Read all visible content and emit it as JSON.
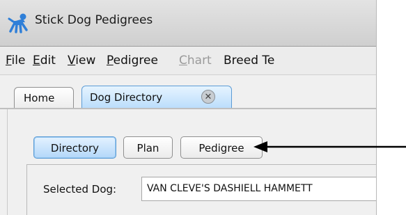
{
  "window": {
    "title": "Stick Dog Pedigrees",
    "app_icon": "stick-dog-icon"
  },
  "menubar": {
    "items": [
      {
        "mnemonic": "F",
        "rest": "ile",
        "enabled": true
      },
      {
        "mnemonic": "E",
        "rest": "dit",
        "enabled": true
      },
      {
        "mnemonic": "V",
        "rest": "iew",
        "enabled": true
      },
      {
        "mnemonic": "P",
        "rest": "edigree",
        "enabled": true
      },
      {
        "mnemonic": "C",
        "rest": "hart",
        "enabled": false
      },
      {
        "mnemonic": "",
        "rest": "Breed Te",
        "enabled": true
      }
    ]
  },
  "tabs": [
    {
      "label": "Home",
      "active": false
    },
    {
      "label": "Dog Directory",
      "active": true,
      "closable": true,
      "close_icon": "close-icon"
    }
  ],
  "subtabs": [
    {
      "label": "Directory",
      "active": true
    },
    {
      "label": "Plan",
      "active": false
    },
    {
      "label": "Pedigree",
      "active": false
    }
  ],
  "selected_dog": {
    "label": "Selected Dog:",
    "value": "VAN CLEVE'S DASHIELL HAMMETT"
  },
  "colors": {
    "active_tab": "#b9dcfb",
    "active_border": "#5b9bd5",
    "app_icon": "#2f7fd8"
  }
}
